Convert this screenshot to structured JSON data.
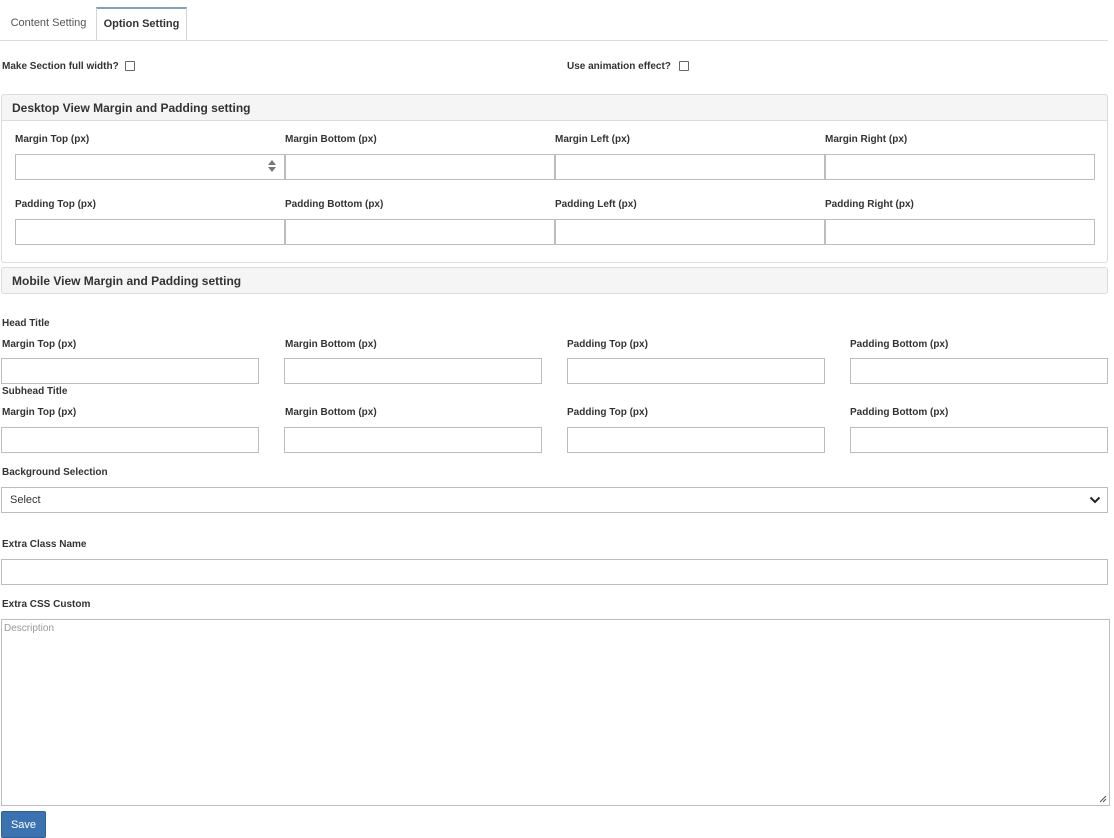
{
  "tabs": [
    {
      "label": "Content Setting",
      "active": false
    },
    {
      "label": "Option Setting",
      "active": true
    }
  ],
  "options": {
    "full_width_label": "Make Section full width?",
    "full_width_checked": false,
    "animation_label": "Use animation effect?",
    "animation_checked": false
  },
  "desktop": {
    "title": "Desktop View Margin and Padding setting",
    "margin_labels": [
      "Margin Top (px)",
      "Margin Bottom (px)",
      "Margin Left (px)",
      "Margin Right (px)"
    ],
    "padding_labels": [
      "Padding Top (px)",
      "Padding Bottom (px)",
      "Padding Left (px)",
      "Padding Right (px)"
    ]
  },
  "mobile": {
    "title": "Mobile View Margin and Padding setting"
  },
  "head_title": {
    "label": "Head Title",
    "field_labels": [
      "Margin Top (px)",
      "Margin Bottom (px)",
      "Padding Top (px)",
      "Padding Bottom (px)"
    ]
  },
  "subhead_title": {
    "label": "Subhead Title",
    "field_labels": [
      "Margin Top (px)",
      "Margin Bottom (px)",
      "Padding Top (px)",
      "Padding Bottom (px)"
    ]
  },
  "background": {
    "label": "Background Selection",
    "selected": "Select"
  },
  "extra_class": {
    "label": "Extra Class Name",
    "value": ""
  },
  "extra_css": {
    "label": "Extra CSS Custom",
    "placeholder": "Description"
  },
  "save_label": "Save",
  "colors": {
    "accent": "#3b73b0",
    "tab_active_border": "#7ea1bd",
    "panel_bg": "#f5f5f5"
  }
}
